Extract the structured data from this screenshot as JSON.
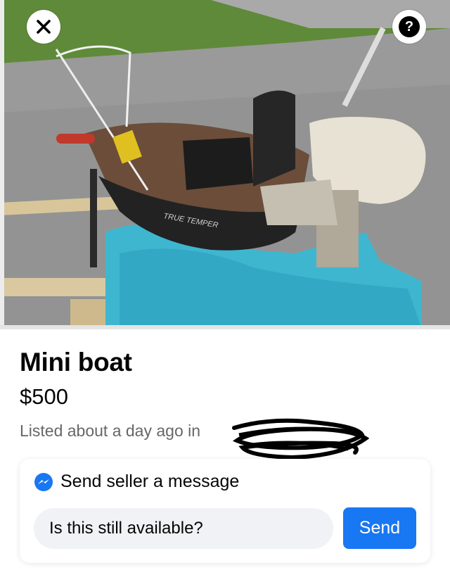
{
  "header": {
    "close_icon": "close-icon",
    "help_icon": "question-mark-icon",
    "help_glyph": "?"
  },
  "photo": {
    "subject": "listing-photo"
  },
  "listing": {
    "title": "Mini boat",
    "price": "$500",
    "listed_text": "Listed about a day ago in"
  },
  "message_card": {
    "icon": "messenger-icon",
    "heading": "Send seller a message",
    "input_value": "Is this still available?",
    "send_label": "Send"
  },
  "colors": {
    "accent": "#1877f2",
    "secondary_text": "#65676b",
    "input_bg": "#f0f2f5"
  }
}
